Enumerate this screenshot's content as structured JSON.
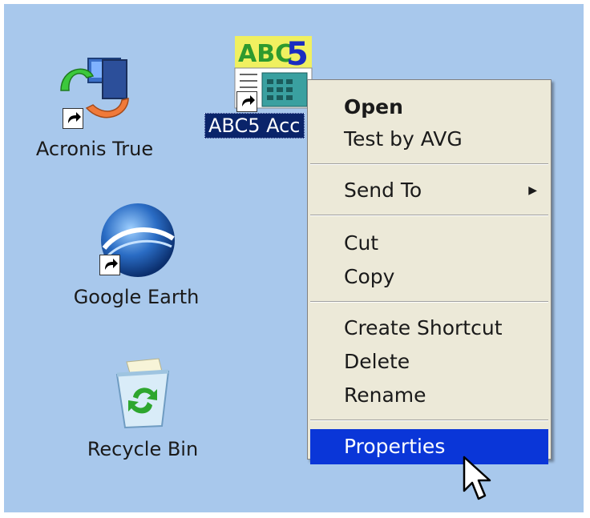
{
  "desktop": {
    "background_color": "#a8c8ec",
    "icons": [
      {
        "label": "Acronis True",
        "icon": "acronis-icon"
      },
      {
        "label": "Google Earth",
        "icon": "google-earth-icon"
      },
      {
        "label": "Recycle Bin",
        "icon": "recycle-bin-icon"
      },
      {
        "label": "ABC5 Acc",
        "icon": "abc5-icon",
        "selected": true
      }
    ]
  },
  "context_menu": {
    "items": [
      {
        "label": "Open",
        "bold": true
      },
      {
        "label": "Test by AVG"
      },
      {
        "label": "Send To",
        "submenu": true
      },
      {
        "label": "Cut"
      },
      {
        "label": "Copy"
      },
      {
        "label": "Create Shortcut"
      },
      {
        "label": "Delete"
      },
      {
        "label": "Rename"
      },
      {
        "label": "Properties",
        "highlighted": true
      }
    ],
    "highlight_color": "#0a36d8"
  }
}
